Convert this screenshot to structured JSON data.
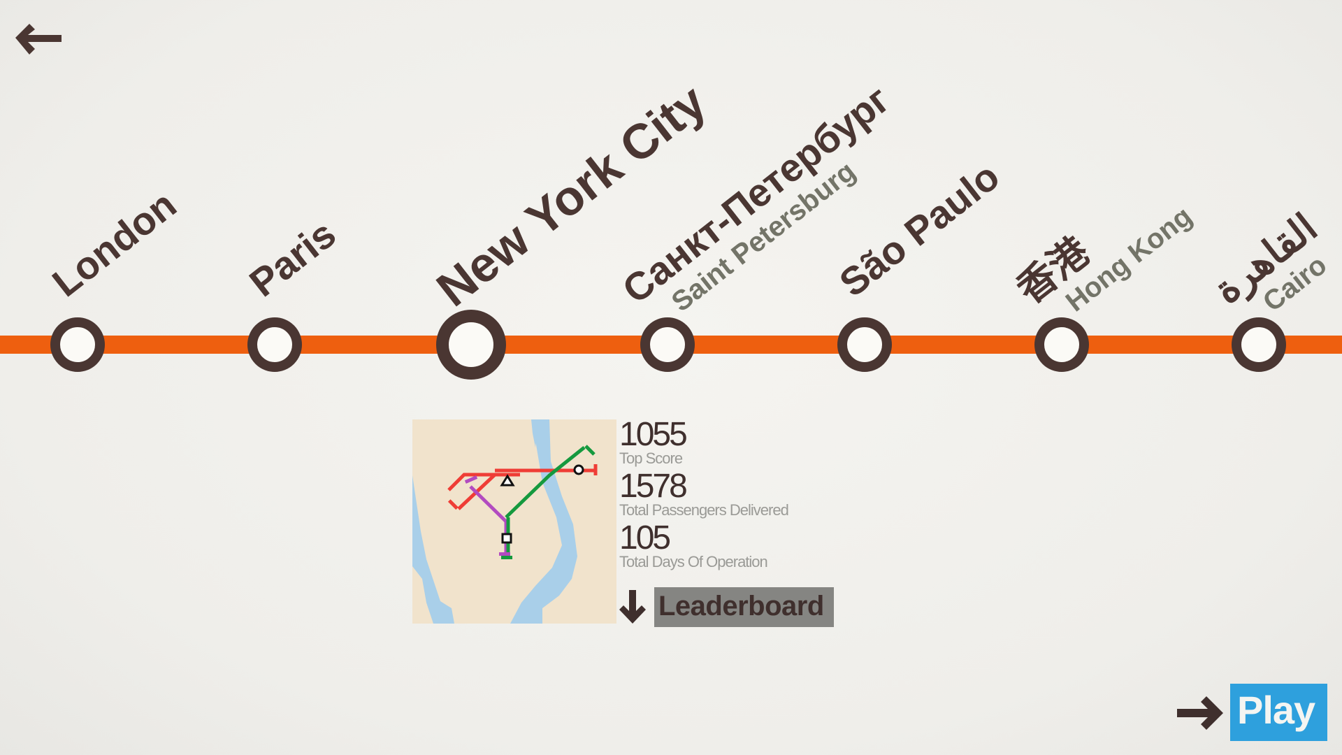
{
  "nav": {
    "back_icon": "arrow-left-icon",
    "play_icon": "arrow-right-icon",
    "play_label": "Play"
  },
  "colors": {
    "line": "#ee5f0f",
    "station_ring": "#4a3632",
    "text_primary": "#4a3632",
    "text_secondary": "#737468",
    "play_button": "#2ea0dd",
    "leaderboard_button": "#858582"
  },
  "cities": [
    {
      "name": "London",
      "sub": ""
    },
    {
      "name": "Paris",
      "sub": ""
    },
    {
      "name": "New York City",
      "sub": "",
      "selected": true
    },
    {
      "name": "Санкт-Петербург",
      "sub": "Saint Petersburg"
    },
    {
      "name": "São Paulo",
      "sub": ""
    },
    {
      "name": "香港",
      "sub": "Hong Kong"
    },
    {
      "name": "القاهرة",
      "sub": "Cairo"
    }
  ],
  "selected_city": {
    "map_thumbnail_icon": "new-york-map-icon",
    "stats": [
      {
        "value": "1055",
        "label": "Top Score"
      },
      {
        "value": "1578",
        "label": "Total Passengers Delivered"
      },
      {
        "value": "105",
        "label": "Total Days Of Operation"
      }
    ],
    "leaderboard_icon": "arrow-down-icon",
    "leaderboard_label": "Leaderboard"
  }
}
